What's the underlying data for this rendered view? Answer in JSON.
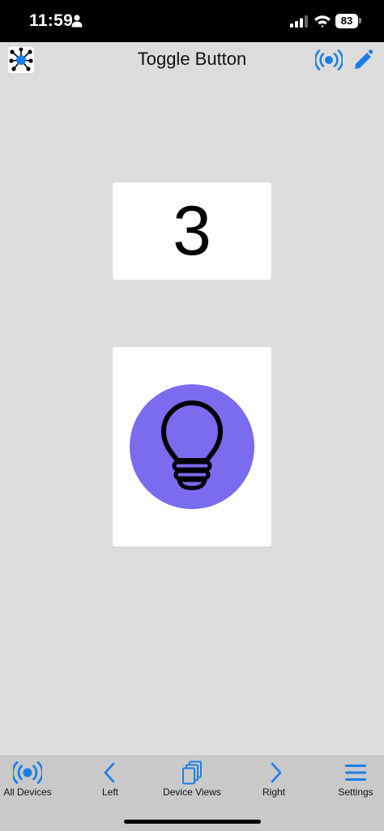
{
  "status_bar": {
    "time": "11:59",
    "battery": "83"
  },
  "nav": {
    "title": "Toggle Button",
    "logo_icon": "network-hub-icon",
    "right_icons": [
      "broadcast-icon",
      "pencil-icon"
    ]
  },
  "counter": {
    "value": "3"
  },
  "toggle": {
    "icon": "lightbulb-icon",
    "state_color": "#7a6cee"
  },
  "tabs": [
    {
      "label": "All Devices",
      "icon": "broadcast-icon"
    },
    {
      "label": "Left",
      "icon": "chevron-left-icon"
    },
    {
      "label": "Device Views",
      "icon": "stacked-pages-icon"
    },
    {
      "label": "Right",
      "icon": "chevron-right-icon"
    },
    {
      "label": "Settings",
      "icon": "hamburger-menu-icon"
    }
  ],
  "colors": {
    "accent": "#1a7ee6",
    "background": "#dcdcdc",
    "tab_bar": "#c9c9c9",
    "toggle_on": "#7a6cee"
  }
}
